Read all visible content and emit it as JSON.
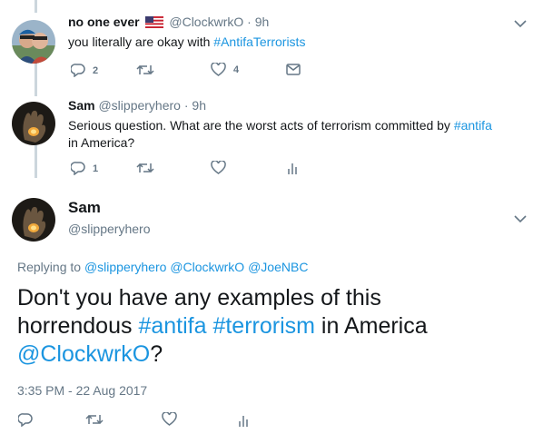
{
  "tweet1": {
    "display_name": "no one ever",
    "handle": "@ClockwrkO",
    "time": "9h",
    "text_plain": "you literally are okay with ",
    "hashtag": "#AntifaTerrorists",
    "reply_count": "2",
    "like_count": "4"
  },
  "tweet2": {
    "display_name": "Sam",
    "handle": "@slipperyhero",
    "time": "9h",
    "text_plain": "Serious question. What are the worst acts of terrorism committed by ",
    "hashtag": "#antifa",
    "text_line2": "in America?",
    "reply_count": "1"
  },
  "main": {
    "display_name": "Sam",
    "handle": "@slipperyhero",
    "replying_label": "Replying to",
    "replying_handles": [
      "@slipperyhero",
      "@ClockwrkO",
      "@JoeNBC"
    ],
    "text_l1": "Don't you have any examples of this",
    "text_l2_a": "horrendous ",
    "hashtag1": "#antifa",
    "hashtag2": "#terrorism",
    "text_l2_b": " in America",
    "mention": "@ClockwrkO",
    "text_l3_end": "?",
    "timestamp": "3:35 PM - 22 Aug 2017"
  },
  "colors": {
    "link": "#1b95e0",
    "muted": "#657786",
    "line": "#ccd6dd"
  },
  "icons": [
    "reply-icon",
    "retweet-icon",
    "like-icon",
    "message-icon",
    "analytics-icon",
    "chevron-down-icon",
    "us-flag-icon"
  ]
}
